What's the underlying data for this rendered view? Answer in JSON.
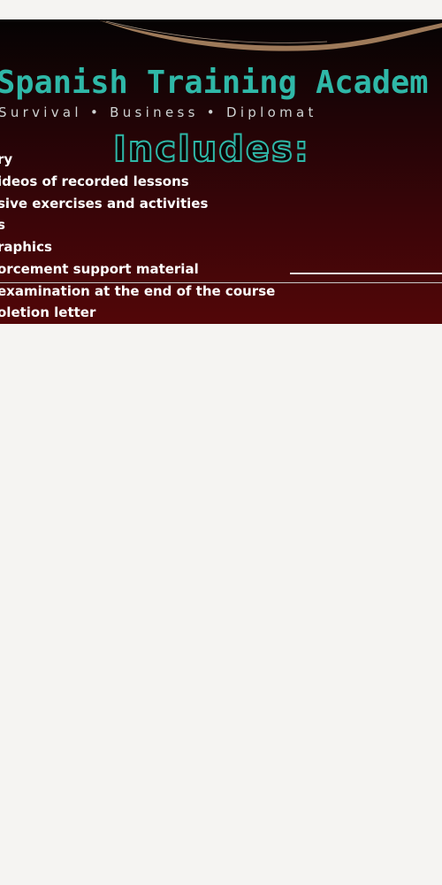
{
  "banner": {
    "title": "Spanish Training Academ",
    "tagline": "Survival • Business • Diplomat",
    "includes_heading": "Includes:",
    "features": [
      "ry",
      "ideos of recorded lessons",
      "sive exercises and activities",
      "s",
      "raphics",
      "orcement support material",
      "examination at the end of the course",
      "oletion letter"
    ]
  },
  "colors": {
    "accent": "#2fb8a8",
    "background_top": "#050303",
    "background_bottom": "#520608",
    "page_background": "#f5f4f2",
    "swoosh": "#b98f6a"
  }
}
